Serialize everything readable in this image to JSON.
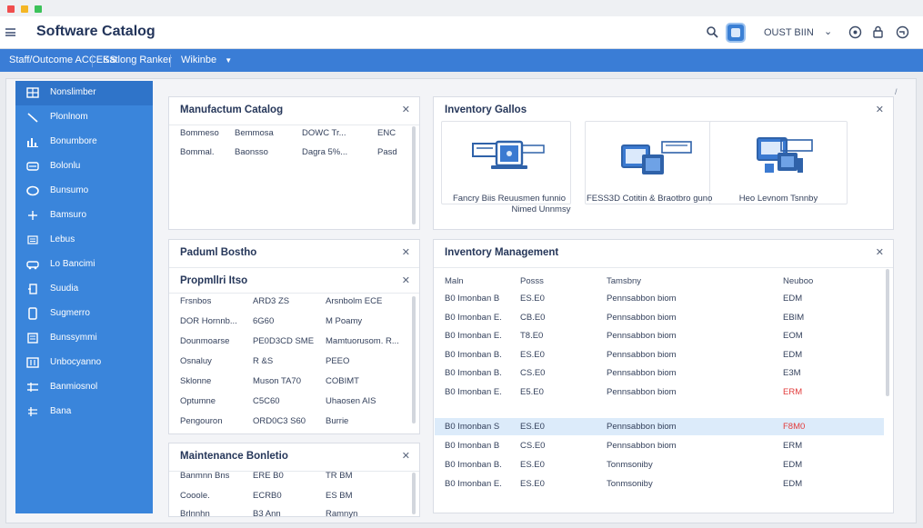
{
  "app": {
    "title": "Software Catalog"
  },
  "topbar": {
    "user_name": "OUST BIIN",
    "icons": [
      "menu-icon",
      "search-icon",
      "user-badge-icon",
      "chevron-down-icon",
      "help-icon",
      "lock-icon",
      "globe-icon"
    ]
  },
  "menu": {
    "items": [
      "Staff/Outcome ACCESS",
      "Katlong Ranker",
      "Wikinbe"
    ]
  },
  "sidebar": {
    "items": [
      {
        "label": "Nonslimber",
        "icon": "grid-icon",
        "active": true
      },
      {
        "label": "Plonlnom",
        "icon": "wand-icon"
      },
      {
        "label": "Bonumbore",
        "icon": "chart-icon"
      },
      {
        "label": "Bolonlu",
        "icon": "card-icon"
      },
      {
        "label": "Bunsumo",
        "icon": "circle-icon"
      },
      {
        "label": "Bamsuro",
        "icon": "plus-icon"
      },
      {
        "label": "Lebus",
        "icon": "list-icon"
      },
      {
        "label": "Lo Bancimi",
        "icon": "car-icon"
      },
      {
        "label": "Suudia",
        "icon": "key-icon"
      },
      {
        "label": "Sugmerro",
        "icon": "device-icon"
      },
      {
        "label": "Bunssymmi",
        "icon": "document-icon"
      },
      {
        "label": "Unbocyanno",
        "icon": "table-icon"
      },
      {
        "label": "Banmiosnol",
        "icon": "settings-icon"
      },
      {
        "label": "Bana",
        "icon": "tree-icon"
      }
    ]
  },
  "panels": {
    "manufacturer": {
      "title": "Manufactum Catalog",
      "rows": [
        [
          "Bommeso",
          "Bemmosa",
          "DOWC Tr...",
          "ENC"
        ],
        [
          "Bommal.",
          "Baonsso",
          "Dagra 5%...",
          "Pasd"
        ]
      ]
    },
    "inventory_gallery": {
      "title": "Inventory Gallos",
      "tiles": [
        {
          "caption": [
            "Fancry Biis Reuusmen funnio",
            "Nimed Unnmsy"
          ],
          "icon": "laptop-icon"
        },
        {
          "caption": [
            "FESS3D Cotitin & Braotbro guno"
          ],
          "icon": "folders-icon"
        },
        {
          "caption": [
            "Heo Levnom Tsnnby"
          ],
          "icon": "devices-icon"
        }
      ]
    },
    "product_section": {
      "title": "Paduml Bostho",
      "sub_title": "Propmllri Itso",
      "rows": [
        [
          "Frsnbos",
          "ARD3 ZS",
          "Arsnbolm ECE"
        ],
        [
          "DOR Hornnb...",
          "6G60",
          "M Poamy"
        ],
        [
          "Dounmoarse",
          "PE0D3CD SME",
          "Mamtuorusom. R..."
        ],
        [
          "Osnaluy",
          "R &S",
          "PEEO"
        ],
        [
          "Sklonne",
          "Muson TA70",
          "COBIMT"
        ],
        [
          "Optumne",
          "C5C60",
          "Uhaosen AIS"
        ],
        [
          "Pengouron",
          "ORD0C3 S60",
          "Burrie"
        ]
      ]
    },
    "maintenance": {
      "title": "Maintenance Bonletio",
      "rows": [
        [
          "Banmnn Bns",
          "ERE B0",
          "TR BM"
        ],
        [
          "Cooole.",
          "ECRB0",
          "ES BM"
        ],
        [
          "Brlnnhn",
          "B3 Ann",
          "Ramnyn"
        ]
      ]
    },
    "inventory_management": {
      "title": "Inventory Management",
      "headers": [
        "Maln",
        "Posss",
        "Tamsbny",
        "Neuboo"
      ],
      "rows": [
        [
          "B0 Imonban B",
          "ES.E0",
          "Pennsabbon biom",
          "EDM"
        ],
        [
          "B0 Imonban E.",
          "CB.E0",
          "Pennsabbon biom",
          "EBIM"
        ],
        [
          "B0 Imonban E.",
          "T8.E0",
          "Pennsabbon biom",
          "EOM"
        ],
        [
          "B0 Imonban B.",
          "ES.E0",
          "Pennsabbon biom",
          "EDM"
        ],
        [
          "B0 Imonban B.",
          "CS.E0",
          "Pennsabbon biom",
          "E3M"
        ],
        [
          "B0 Imonban E.",
          "E5.E0",
          "Pennsabbon biom",
          "ERM"
        ],
        [
          "B0 Imonban S",
          "ES.E0",
          "Pennsabbon biom",
          "F8M0"
        ],
        [
          "B0 Imonban B",
          "CS.E0",
          "Pennsabbon biom",
          "ERM"
        ],
        [
          "B0 Imonban B.",
          "ES.E0",
          "Tonmsoniby",
          "EDM"
        ],
        [
          "B0 Imonban E.",
          "ES.E0",
          "Tonmsoniby",
          "EDM"
        ]
      ],
      "highlighted_row": 6,
      "alert_color": "#e23b3b"
    }
  },
  "colors": {
    "accent": "#3a7dd6",
    "sidebar": "#3a85db",
    "highlight": "#dcebfa"
  }
}
